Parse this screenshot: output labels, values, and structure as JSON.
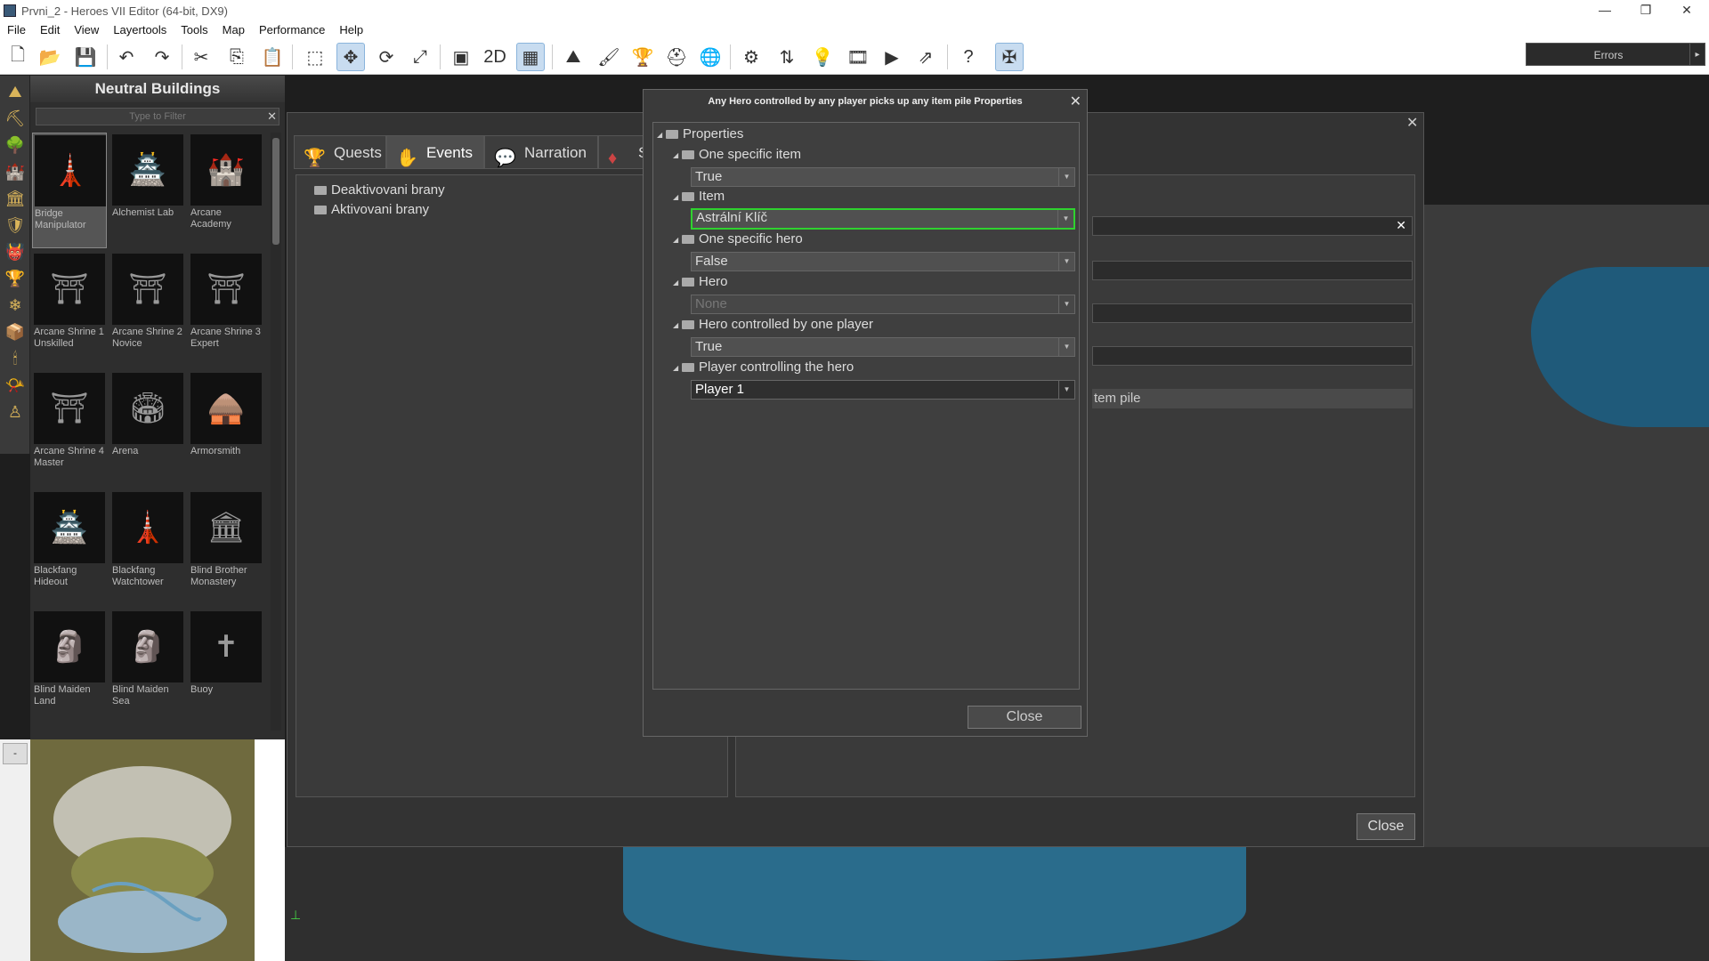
{
  "window": {
    "title": "Prvni_2 - Heroes VII Editor (64-bit, DX9)",
    "minimize": "—",
    "restore": "❐",
    "close": "✕"
  },
  "menu": [
    "File",
    "Edit",
    "View",
    "Layertools",
    "Tools",
    "Map",
    "Performance",
    "Help"
  ],
  "toolbar": {
    "errors_label": "Errors",
    "errors_arrow": "▸",
    "icons": [
      "new-file-icon",
      "open-folder-icon",
      "save-icon",
      "undo-icon",
      "redo-icon",
      "cut-icon",
      "copy-icon",
      "paste-icon",
      "select-icon",
      "move-icon",
      "rotate-icon",
      "scale-icon",
      "screen-icon",
      "2d-icon",
      "grid-icon",
      "terrain-raise-icon",
      "terrain-paint-icon",
      "trophy-icon",
      "helmet-icon",
      "globe-icon",
      "gears-icon",
      "arrows-icon",
      "bulb-icon",
      "film-icon",
      "play-icon",
      "export-icon",
      "help-icon",
      "game-icon"
    ]
  },
  "palette": {
    "header": "Neutral Buildings",
    "filter_placeholder": "Type to Filter",
    "filter_clear": "✕",
    "items": [
      {
        "label": "Bridge Manipulator"
      },
      {
        "label": "Alchemist Lab"
      },
      {
        "label": "Arcane Academy"
      },
      {
        "label": "Arcane Shrine 1 Unskilled"
      },
      {
        "label": "Arcane Shrine 2 Novice"
      },
      {
        "label": "Arcane Shrine 3 Expert"
      },
      {
        "label": "Arcane Shrine 4 Master"
      },
      {
        "label": "Arena"
      },
      {
        "label": "Armorsmith"
      },
      {
        "label": "Blackfang Hideout"
      },
      {
        "label": "Blackfang Watchtower"
      },
      {
        "label": "Blind Brother Monastery"
      },
      {
        "label": "Blind Maiden Land"
      },
      {
        "label": "Blind Maiden Sea"
      },
      {
        "label": "Buoy"
      }
    ]
  },
  "minimap": {
    "toggle": "-"
  },
  "events_window": {
    "tabs": [
      "Quests",
      "Events",
      "Narration",
      "S"
    ],
    "tree": [
      "Deaktivovani brany",
      "Aktivovani brany"
    ],
    "partial_text": "tem pile",
    "close_label": "Close",
    "close_x": "✕"
  },
  "dialog": {
    "title": "Any Hero controlled by any player picks up any item pile Properties",
    "close_x": "✕",
    "root": "Properties",
    "properties": [
      {
        "name": "One specific item",
        "value": "True",
        "state": "normal"
      },
      {
        "name": "Item",
        "value": "Astrální Klíč",
        "state": "highlighted"
      },
      {
        "name": "One specific hero",
        "value": "False",
        "state": "normal"
      },
      {
        "name": "Hero",
        "value": "None",
        "state": "disabled"
      },
      {
        "name": "Hero controlled by one player",
        "value": "True",
        "state": "normal"
      },
      {
        "name": "Player controlling the hero",
        "value": "Player 1",
        "state": "bright"
      }
    ],
    "close_label": "Close"
  }
}
